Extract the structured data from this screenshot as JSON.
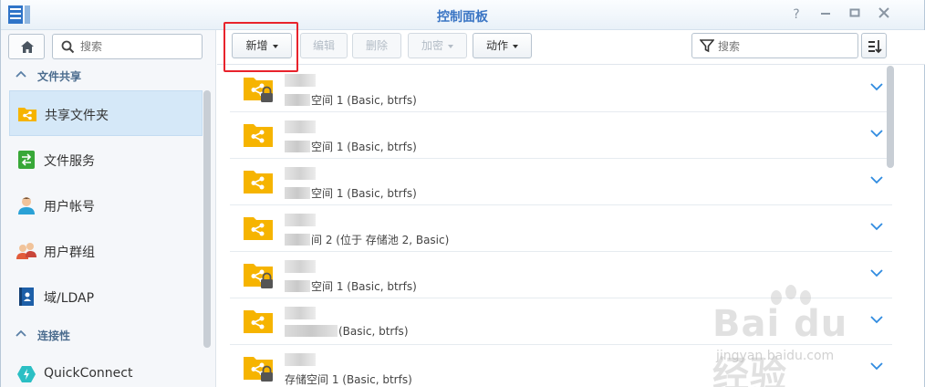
{
  "window": {
    "title": "控制面板"
  },
  "sidebar": {
    "search_placeholder": "搜索",
    "sections": [
      {
        "label": "文件共享"
      },
      {
        "label": "连接性"
      }
    ],
    "items": [
      {
        "label": "共享文件夹",
        "icon": "shared-folder-icon",
        "active": true
      },
      {
        "label": "文件服务",
        "icon": "file-services-icon"
      },
      {
        "label": "用户帐号",
        "icon": "user-icon"
      },
      {
        "label": "用户群组",
        "icon": "group-icon"
      },
      {
        "label": "域/LDAP",
        "icon": "domain-ldap-icon"
      },
      {
        "label": "QuickConnect",
        "icon": "quickconnect-icon"
      }
    ]
  },
  "toolbar": {
    "create": "新增",
    "edit": "编辑",
    "delete": "删除",
    "encrypt": "加密",
    "action": "动作",
    "filter_placeholder": "搜索"
  },
  "folders": [
    {
      "desc": "空间 1 (Basic, btrfs)",
      "locked": true
    },
    {
      "desc": "空间 1 (Basic, btrfs)",
      "locked": false
    },
    {
      "desc": "空间 1 (Basic, btrfs)",
      "locked": false
    },
    {
      "desc": "间 2 (位于 存储池 2, Basic)",
      "locked": false
    },
    {
      "desc": "空间 1 (Basic, btrfs)",
      "locked": true
    },
    {
      "desc": "(Basic, btrfs)",
      "locked": false
    },
    {
      "desc": "存储空间 1 (Basic, btrfs)",
      "locked": true
    }
  ],
  "watermark": {
    "main": "Bai du 经验",
    "sub": "jingyan.baidu.com"
  },
  "colors": {
    "title": "#3a75c4",
    "accent": "#2f8be0",
    "folder": "#f6b400",
    "highlight": "#e8232c"
  }
}
